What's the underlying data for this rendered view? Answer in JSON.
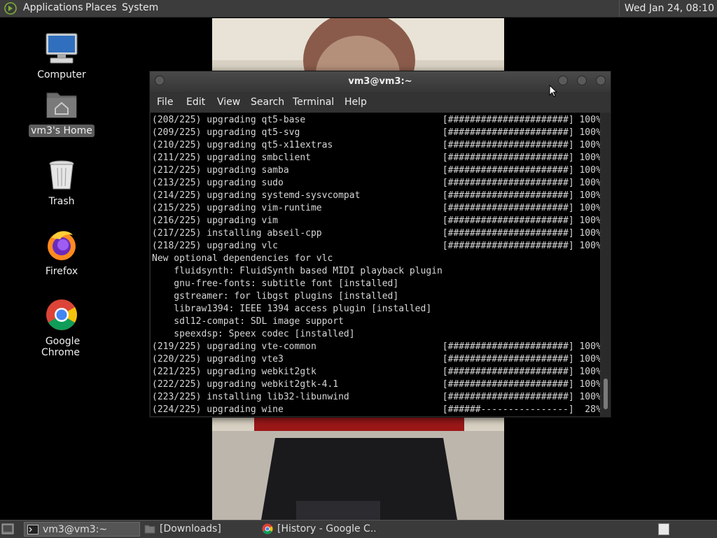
{
  "top_panel": {
    "menus": [
      "Applications",
      "Places",
      "System"
    ],
    "clock": "Wed Jan 24, 08:10"
  },
  "desktop_icons": [
    {
      "label": "Computer",
      "icon": "computer-icon"
    },
    {
      "label": "vm3's Home",
      "icon": "home-folder-icon"
    },
    {
      "label": "Trash",
      "icon": "trash-icon"
    },
    {
      "label": "Firefox",
      "icon": "firefox-icon"
    },
    {
      "label": "Google Chrome",
      "icon": "chrome-icon"
    }
  ],
  "terminal": {
    "title": "vm3@vm3:~",
    "menu": [
      "File",
      "Edit",
      "View",
      "Search",
      "Terminal",
      "Help"
    ],
    "lines": [
      "(208/225) upgrading qt5-base                         [######################] 100%",
      "(209/225) upgrading qt5-svg                          [######################] 100%",
      "(210/225) upgrading qt5-x11extras                    [######################] 100%",
      "(211/225) upgrading smbclient                        [######################] 100%",
      "(212/225) upgrading samba                            [######################] 100%",
      "(213/225) upgrading sudo                             [######################] 100%",
      "(214/225) upgrading systemd-sysvcompat               [######################] 100%",
      "(215/225) upgrading vim-runtime                      [######################] 100%",
      "(216/225) upgrading vim                              [######################] 100%",
      "(217/225) installing abseil-cpp                      [######################] 100%",
      "(218/225) upgrading vlc                              [######################] 100%",
      "New optional dependencies for vlc",
      "    fluidsynth: FluidSynth based MIDI playback plugin",
      "    gnu-free-fonts: subtitle font [installed]",
      "    gstreamer: for libgst plugins [installed]",
      "    libraw1394: IEEE 1394 access plugin [installed]",
      "    sdl12-compat: SDL image support",
      "    speexdsp: Speex codec [installed]",
      "(219/225) upgrading vte-common                       [######################] 100%",
      "(220/225) upgrading vte3                             [######################] 100%",
      "(221/225) upgrading webkit2gtk                       [######################] 100%",
      "(222/225) upgrading webkit2gtk-4.1                   [######################] 100%",
      "(223/225) installing lib32-libunwind                 [######################] 100%",
      "(224/225) upgrading wine                             [######----------------]  28%"
    ]
  },
  "taskbar": {
    "tasks": [
      {
        "label": "vm3@vm3:~",
        "icon": "terminal-icon",
        "active": true
      },
      {
        "label": "[Downloads]",
        "icon": "folder-icon",
        "active": false
      },
      {
        "label": "[History - Google C...",
        "icon": "chrome-icon",
        "active": false
      }
    ]
  }
}
